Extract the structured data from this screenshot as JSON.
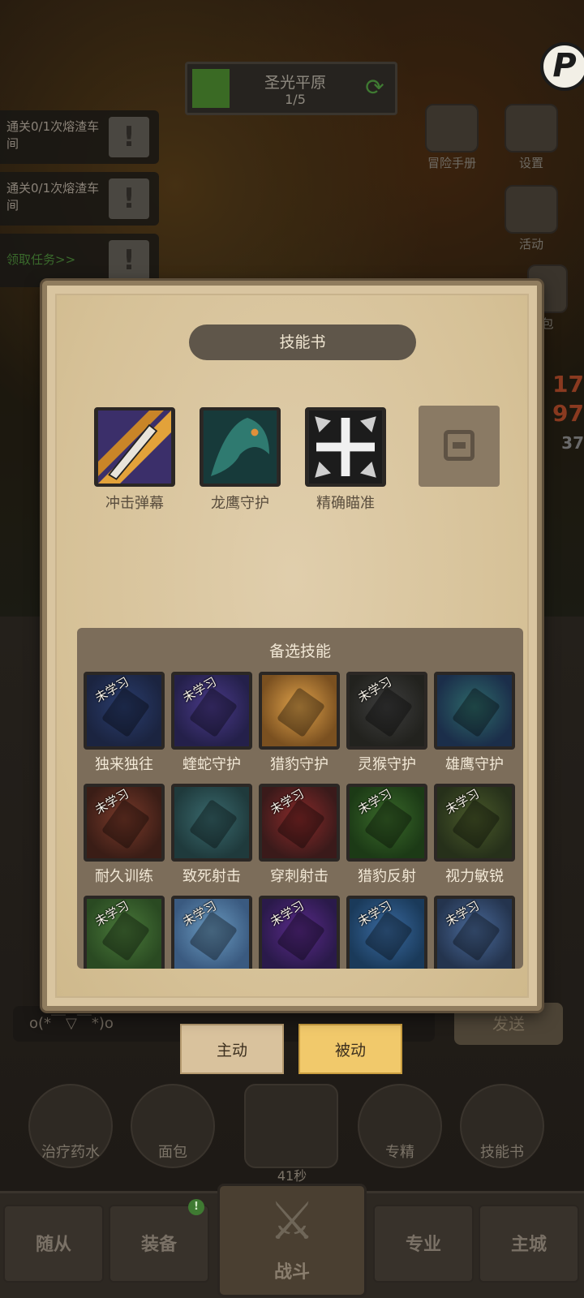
{
  "stage": {
    "name": "圣光平原",
    "progress": "1/5"
  },
  "quests": [
    {
      "text": "通关0/1次熔渣车间"
    },
    {
      "text": "通关0/1次熔渣车间"
    },
    {
      "text": "领取任务>>"
    }
  ],
  "side_menu": {
    "adventure": "冒险手册",
    "settings": "设置",
    "activity": "活动",
    "bag_partial": "包"
  },
  "right_numbers": [
    "17",
    "97",
    "37"
  ],
  "modal": {
    "title": "技能书",
    "equipped": [
      {
        "label": "冲击弹幕",
        "icon": "impact-barrage-icon"
      },
      {
        "label": "龙鹰守护",
        "icon": "dragonhawk-guard-icon"
      },
      {
        "label": "精确瞄准",
        "icon": "precise-aim-icon"
      }
    ],
    "locked_slot_icon": "lock-icon",
    "candidates_title": "备选技能",
    "unlearned_tag": "未学习",
    "candidates": [
      {
        "label": "独来独往",
        "learned": false,
        "colors": [
          "#2a3d6e",
          "#1b2440"
        ]
      },
      {
        "label": "蝰蛇守护",
        "learned": false,
        "colors": [
          "#4a3a8a",
          "#24204a"
        ]
      },
      {
        "label": "猎豹守护",
        "learned": true,
        "colors": [
          "#e0a24a",
          "#7a5020"
        ]
      },
      {
        "label": "灵猴守护",
        "learned": false,
        "colors": [
          "#3e3e3e",
          "#22221e"
        ]
      },
      {
        "label": "雄鹰守护",
        "learned": true,
        "colors": [
          "#2e6a6a",
          "#1b2e4a"
        ]
      },
      {
        "label": "耐久训练",
        "learned": false,
        "colors": [
          "#7a3a2a",
          "#3a1d16"
        ]
      },
      {
        "label": "致死射击",
        "learned": true,
        "colors": [
          "#3a6a6e",
          "#1f3a3c"
        ]
      },
      {
        "label": "穿刺射击",
        "learned": false,
        "colors": [
          "#8a2a2a",
          "#3a1a1a"
        ]
      },
      {
        "label": "猎豹反射",
        "learned": false,
        "colors": [
          "#3a6a2a",
          "#1c3a16"
        ]
      },
      {
        "label": "视力敏锐",
        "learned": false,
        "colors": [
          "#4a5a2a",
          "#26301a"
        ]
      },
      {
        "label": "",
        "learned": false,
        "colors": [
          "#4a7a3a",
          "#2a4a22"
        ]
      },
      {
        "label": "",
        "learned": false,
        "colors": [
          "#6a9ac0",
          "#3a5a80"
        ]
      },
      {
        "label": "",
        "learned": false,
        "colors": [
          "#5a2a8a",
          "#2a1a4a"
        ]
      },
      {
        "label": "",
        "learned": false,
        "colors": [
          "#3a6aa0",
          "#1a3a5a"
        ]
      },
      {
        "label": "",
        "learned": false,
        "colors": [
          "#4a6a9a",
          "#24344e"
        ]
      }
    ]
  },
  "chat": {
    "placeholder": "o(*￣▽￣*)o",
    "send": "发送"
  },
  "tabs": {
    "active": "主动",
    "passive": "被动"
  },
  "quick_items": [
    {
      "label": "治疗药水",
      "icon": "potion-icon"
    },
    {
      "label": "面包",
      "icon": "bread-icon"
    },
    {
      "label": "41秒",
      "icon": "chest-icon"
    },
    {
      "label": "专精",
      "icon": "specialization-icon"
    },
    {
      "label": "技能书",
      "icon": "skillbook-icon"
    }
  ],
  "bottom_nav": {
    "followers": "随从",
    "equipment": "装备",
    "battle": "战斗",
    "profession": "专业",
    "main_city": "主城",
    "equipment_badge": "!"
  },
  "colors": {
    "modal_bg": "#d9c5a0",
    "panel_bg": "#7c6d5a",
    "passive_tab": "#f1c96b",
    "active_tab": "#d9c29d"
  }
}
